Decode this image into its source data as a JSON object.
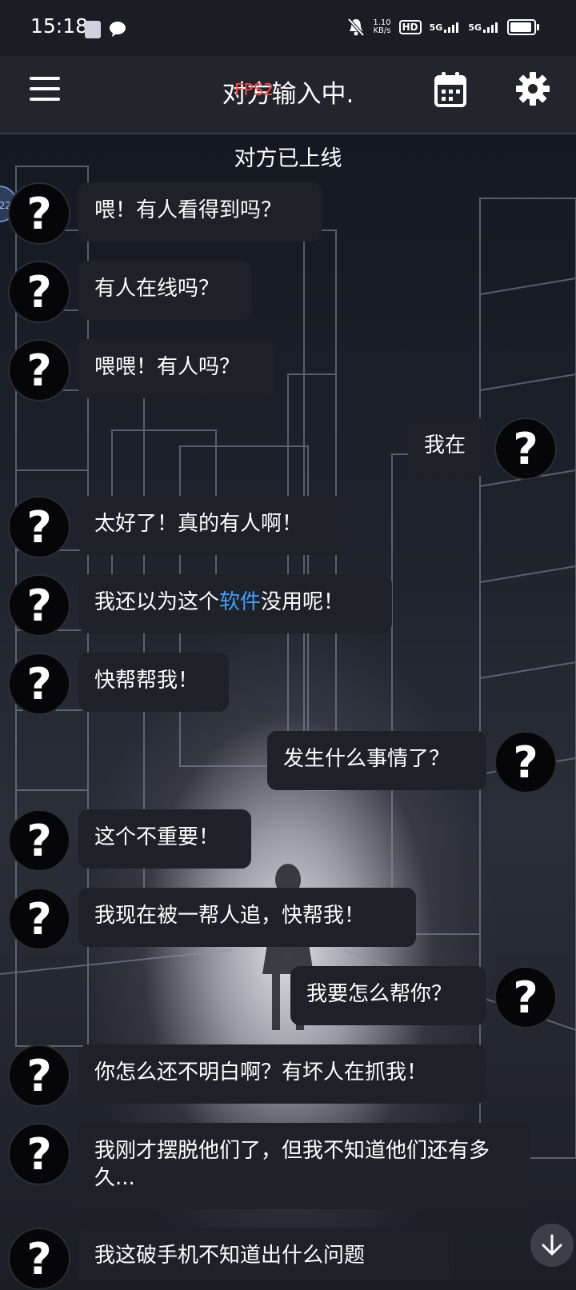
{
  "status_bar": {
    "time": "15:18",
    "net_speed_value": "1.10",
    "net_speed_unit": "KB/s",
    "hd_label": "HD",
    "sim1_label": "5G",
    "sim2_label": "5G"
  },
  "header": {
    "title": "对方输入中.",
    "fps_overlay": "FPS2"
  },
  "notice": "对方已上线",
  "edge_badge": "22",
  "messages": [
    {
      "side": "left",
      "text": "喂！有人看得到吗？"
    },
    {
      "side": "left",
      "text": "有人在线吗？"
    },
    {
      "side": "left",
      "text": "喂喂！有人吗？"
    },
    {
      "side": "right",
      "text": "我在"
    },
    {
      "side": "left",
      "text": "太好了！真的有人啊！"
    },
    {
      "side": "left",
      "text_before": "我还以为这个",
      "link": "软件",
      "text_after": "没用呢！"
    },
    {
      "side": "left",
      "text": "快帮帮我！"
    },
    {
      "side": "right",
      "text": "发生什么事情了？"
    },
    {
      "side": "left",
      "text": "这个不重要！"
    },
    {
      "side": "left",
      "text": "我现在被一帮人追，快帮我！"
    },
    {
      "side": "right",
      "text": "我要怎么帮你？"
    },
    {
      "side": "left",
      "text": "你怎么还不明白啊？有坏人在抓我！"
    },
    {
      "side": "left",
      "text": "我刚才摆脱他们了，但我不知道他们还有多久..."
    },
    {
      "side": "left",
      "text": "我这破手机不知道出什么问题"
    }
  ],
  "avatar_glyph": "?",
  "colors": {
    "background": "#1b1d24",
    "bubble": "#1f2129",
    "link": "#3aa0ff",
    "fps": "#ff4b4b"
  },
  "icons": [
    "menu-icon",
    "calendar-icon",
    "gear-icon",
    "scroll-down-icon",
    "mute-icon",
    "wechat-icon",
    "signal-icon",
    "battery-icon"
  ]
}
